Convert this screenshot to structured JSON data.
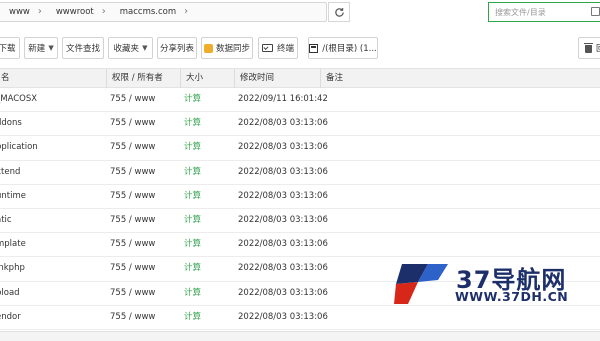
{
  "breadcrumb": {
    "items": [
      "www",
      "wwwroot",
      "maccms.com"
    ],
    "arrow": "›"
  },
  "search": {
    "placeholder": "搜索文件/目录"
  },
  "toolbar": {
    "download_label": "下载",
    "new_label": "新建",
    "file_search_label": "文件查找",
    "favorites_label": "收藏夹",
    "share_list_label": "分享列表",
    "sync_label": "数据同步",
    "terminal_label": "终端",
    "root_dir_label": "/(根目录) (1...",
    "recycle_label": "回"
  },
  "table": {
    "headers": {
      "name": "名",
      "perm": "权限 / 所有者",
      "size": "大小",
      "mtime": "修改时间",
      "note": "备注"
    },
    "rows": [
      {
        "name": "_MACOSX",
        "perm": "755 / www",
        "size": "计算",
        "mtime": "2022/09/11 16:01:42"
      },
      {
        "name": "ddons",
        "perm": "755 / www",
        "size": "计算",
        "mtime": "2022/08/03 03:13:06"
      },
      {
        "name": "pplication",
        "perm": "755 / www",
        "size": "计算",
        "mtime": "2022/08/03 03:13:06"
      },
      {
        "name": "xtend",
        "perm": "755 / www",
        "size": "计算",
        "mtime": "2022/08/03 03:13:06"
      },
      {
        "name": "untime",
        "perm": "755 / www",
        "size": "计算",
        "mtime": "2022/08/03 03:13:06"
      },
      {
        "name": "atic",
        "perm": "755 / www",
        "size": "计算",
        "mtime": "2022/08/03 03:13:06"
      },
      {
        "name": "mplate",
        "perm": "755 / www",
        "size": "计算",
        "mtime": "2022/08/03 03:13:06"
      },
      {
        "name": "inkphp",
        "perm": "755 / www",
        "size": "计算",
        "mtime": "2022/08/03 03:13:06"
      },
      {
        "name": "pload",
        "perm": "755 / www",
        "size": "计算",
        "mtime": "2022/08/03 03:13:06"
      },
      {
        "name": "endor",
        "perm": "755 / www",
        "size": "计算",
        "mtime": "2022/08/03 03:13:06"
      }
    ]
  },
  "watermark": {
    "title": "37导航网",
    "url": "WWW.37DH.CN"
  },
  "colors": {
    "accent_green": "#2fa54a",
    "watermark_blue": "#1d2f6b",
    "watermark_red": "#d62718"
  },
  "icons": {
    "refresh": "refresh-icon",
    "search": "search-icon",
    "sync": "sync-icon",
    "terminal": "terminal-icon",
    "disk": "disk-icon",
    "trash": "trash-icon"
  }
}
